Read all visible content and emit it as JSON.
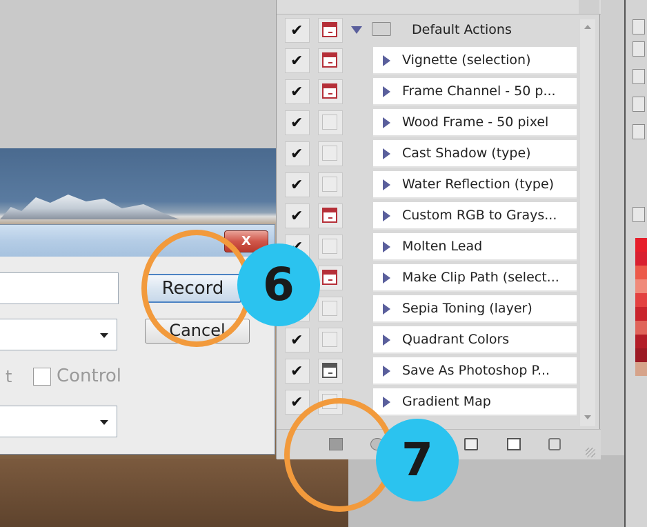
{
  "dialog": {
    "close_label": "X",
    "record_label": "Record",
    "cancel_label": "Cancel",
    "modifier_partial": "t",
    "control_label": "Control"
  },
  "actions_panel": {
    "set_name": "Default Actions",
    "actions": [
      {
        "label": "Vignette (selection)",
        "checked": true,
        "dialog": "red"
      },
      {
        "label": "Frame Channel - 50 p...",
        "checked": true,
        "dialog": "red"
      },
      {
        "label": "Wood Frame - 50 pixel",
        "checked": true,
        "dialog": "none"
      },
      {
        "label": "Cast Shadow (type)",
        "checked": true,
        "dialog": "none"
      },
      {
        "label": "Water Reflection (type)",
        "checked": true,
        "dialog": "none"
      },
      {
        "label": "Custom RGB to Grays...",
        "checked": true,
        "dialog": "red"
      },
      {
        "label": "Molten Lead",
        "checked": true,
        "dialog": "none"
      },
      {
        "label": "Make Clip Path (select...",
        "checked": true,
        "dialog": "red"
      },
      {
        "label": "Sepia Toning (layer)",
        "checked": true,
        "dialog": "none"
      },
      {
        "label": "Quadrant Colors",
        "checked": true,
        "dialog": "none"
      },
      {
        "label": "Save As Photoshop P...",
        "checked": true,
        "dialog": "gray"
      },
      {
        "label": "Gradient Map",
        "checked": true,
        "dialog": "none"
      }
    ]
  },
  "callouts": {
    "step_record": "6",
    "step_stop": "7"
  },
  "colors": {
    "callout_ring": "#f29a3c",
    "callout_badge": "#2bc3ef",
    "dialog_icon_red": "#b52f38",
    "play_icon": "#5a5f9c"
  }
}
